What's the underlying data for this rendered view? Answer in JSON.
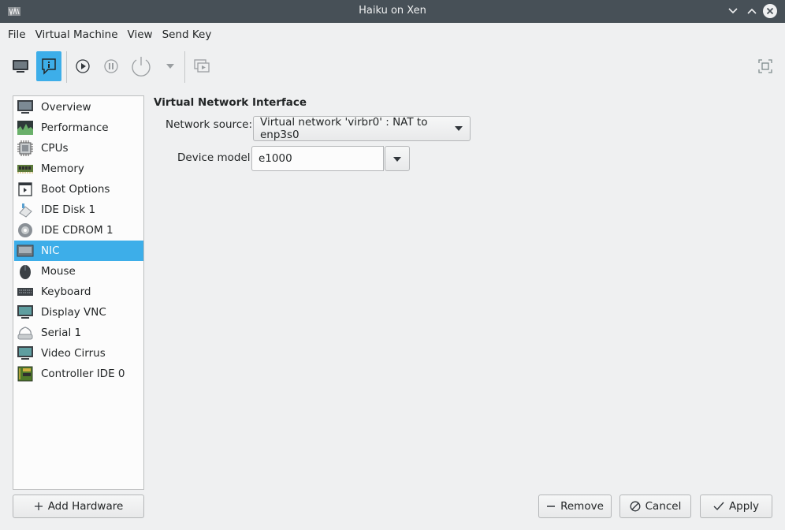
{
  "window": {
    "title": "Haiku on Xen",
    "app_icon": "virt-manager-icon"
  },
  "menubar": {
    "items": [
      "File",
      "Virtual Machine",
      "View",
      "Send Key"
    ]
  },
  "toolbar": {
    "tools": [
      {
        "name": "console-icon",
        "active": false
      },
      {
        "name": "details-icon",
        "active": true
      },
      {
        "name": "run-icon",
        "active": false
      },
      {
        "name": "pause-icon",
        "active": false
      },
      {
        "name": "shutdown-icon",
        "active": false
      },
      {
        "name": "shutdown-menu-icon",
        "active": false
      },
      {
        "name": "snapshots-icon",
        "active": false
      },
      {
        "name": "fullscreen-icon",
        "active": false
      }
    ]
  },
  "sidebar": {
    "items": [
      {
        "label": "Overview",
        "icon": "overview-icon"
      },
      {
        "label": "Performance",
        "icon": "performance-icon"
      },
      {
        "label": "CPUs",
        "icon": "cpu-icon"
      },
      {
        "label": "Memory",
        "icon": "memory-icon"
      },
      {
        "label": "Boot Options",
        "icon": "boot-options-icon"
      },
      {
        "label": "IDE Disk 1",
        "icon": "disk-icon"
      },
      {
        "label": "IDE CDROM 1",
        "icon": "cdrom-icon"
      },
      {
        "label": "NIC",
        "icon": "nic-icon",
        "selected": true
      },
      {
        "label": "Mouse",
        "icon": "mouse-icon"
      },
      {
        "label": "Keyboard",
        "icon": "keyboard-icon"
      },
      {
        "label": "Display VNC",
        "icon": "display-icon"
      },
      {
        "label": "Serial 1",
        "icon": "serial-icon"
      },
      {
        "label": "Video Cirrus",
        "icon": "video-icon"
      },
      {
        "label": "Controller IDE 0",
        "icon": "controller-icon"
      }
    ],
    "add_hardware_label": "Add Hardware"
  },
  "details": {
    "section_title": "Virtual Network Interface",
    "network_source_label": "Network source:",
    "network_source_value": "Virtual network 'virbr0' : NAT to enp3s0",
    "device_model_label": "Device model:",
    "device_model_value": "e1000"
  },
  "footer": {
    "remove_label": "Remove",
    "cancel_label": "Cancel",
    "apply_label": "Apply"
  },
  "colors": {
    "accent": "#3daee9",
    "titlebar": "#475057",
    "background": "#eff0f1"
  }
}
